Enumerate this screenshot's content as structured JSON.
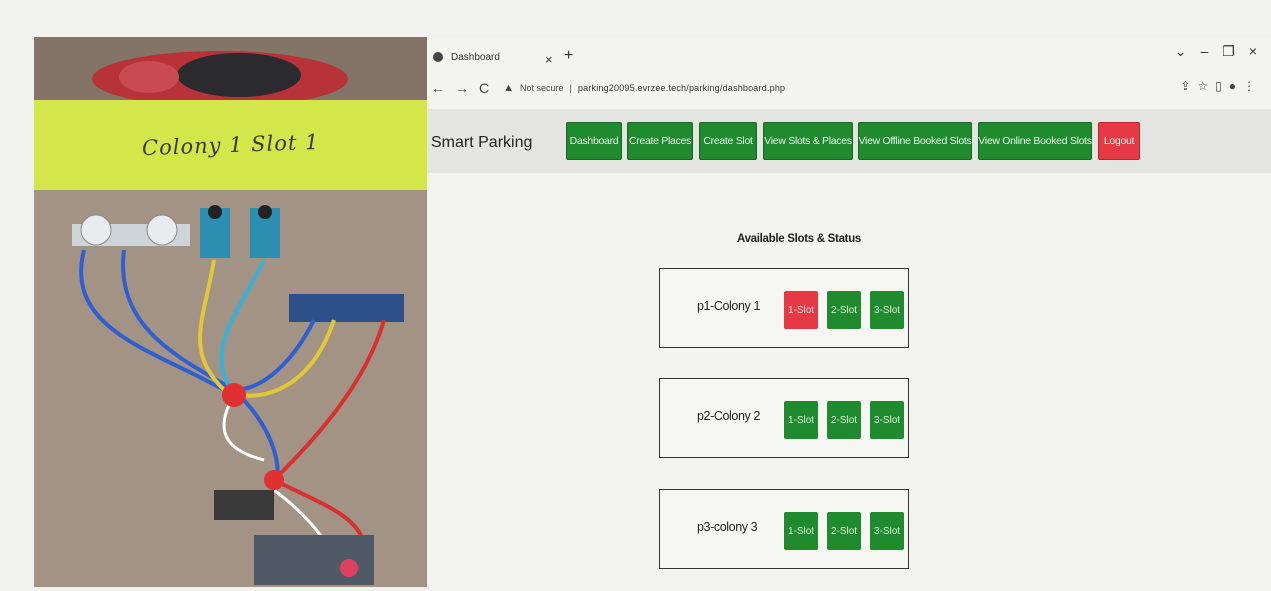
{
  "photo": {
    "banner_text": "Colony 1   Slot 1"
  },
  "browser": {
    "tab_title": "Dashboard",
    "tab_close": "×",
    "new_tab": "+",
    "window_controls": [
      "⌄",
      "–",
      "❐",
      "×"
    ],
    "nav_back": "←",
    "nav_forward": "→",
    "nav_reload": "C",
    "security_icon": "warning-icon",
    "security_text": "Not secure",
    "url": "parking20095.evrzee.tech/parking/dashboard.php",
    "toolbar_icons": [
      "share-icon",
      "star-icon",
      "sidepanel-icon",
      "profile-icon",
      "menu-icon"
    ]
  },
  "app": {
    "brand": "Smart Parking",
    "nav": [
      {
        "label": "Dashboard"
      },
      {
        "label": "Create Places"
      },
      {
        "label": "Create Slot"
      },
      {
        "label": "View Slots & Places"
      },
      {
        "label": "View Offline Booked Slots"
      },
      {
        "label": "View Online Booked Slots"
      },
      {
        "label": "Logout"
      }
    ],
    "section_title": "Available Slots & Status",
    "places": [
      {
        "name": "p1-Colony 1",
        "slots": [
          {
            "label": "1-Slot",
            "status": "occupied"
          },
          {
            "label": "2-Slot",
            "status": "free"
          },
          {
            "label": "3-Slot",
            "status": "free"
          }
        ]
      },
      {
        "name": "p2-Colony 2",
        "slots": [
          {
            "label": "1-Slot",
            "status": "free"
          },
          {
            "label": "2-Slot",
            "status": "free"
          },
          {
            "label": "3-Slot",
            "status": "free"
          }
        ]
      },
      {
        "name": "p3-colony 3",
        "slots": [
          {
            "label": "1-Slot",
            "status": "free"
          },
          {
            "label": "2-Slot",
            "status": "free"
          },
          {
            "label": "3-Slot",
            "status": "free"
          }
        ]
      }
    ]
  },
  "colors": {
    "free": "#1f8a2e",
    "occupied": "#e53945",
    "banner": "#d3e64a"
  }
}
